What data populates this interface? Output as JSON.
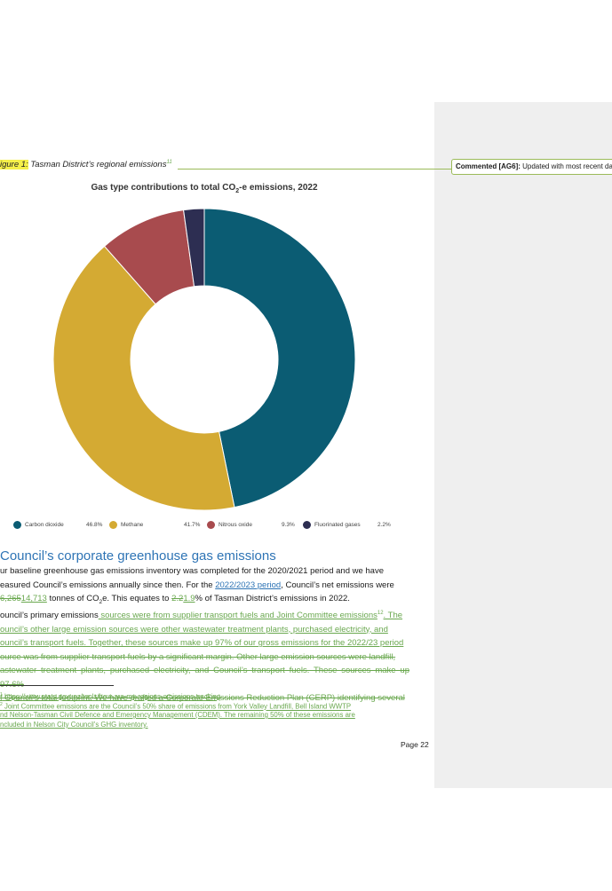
{
  "comment": {
    "label": "Commented [AG6]:",
    "text": " Updated with most recent da"
  },
  "caption": {
    "prefix": "igure 1",
    "marker": ":",
    "text": " Tasman District’s regional emissions",
    "ref": "11"
  },
  "chart_data": {
    "type": "pie",
    "title": "Gas type contributions to total CO",
    "title_sub": "2",
    "title_suffix": "-e emissions, 2022",
    "slices": [
      {
        "label": "Carbon dioxide",
        "value": 46.8,
        "pct_text": "46.8%",
        "color": "#0b5c73"
      },
      {
        "label": "Methane",
        "value": 41.7,
        "pct_text": "41.7%",
        "color": "#d4aa33"
      },
      {
        "label": "Nitrous oxide",
        "value": 9.3,
        "pct_text": "9.3%",
        "color": "#a84b4e"
      },
      {
        "label": "Fluorinated gases",
        "value": 2.2,
        "pct_text": "2.2%",
        "color": "#2d2e52"
      }
    ]
  },
  "section": {
    "heading": "Council’s corporate greenhouse gas emissions"
  },
  "para1": {
    "l1": "ur baseline greenhouse gas emissions inventory was completed for the 2020/2021 period and we have",
    "l2a": "easured Council’s emissions annually since then. For the ",
    "l2link": "2022/2023 period",
    "l2b": ", Council’s net emissions were",
    "l3del1": "6,265",
    "l3ins1": "14,713",
    "l3a": " tonnes of CO",
    "l3sub": "2",
    "l3b": "e. This equates to ",
    "l3del2": "2.2",
    "l3ins2": "1.9",
    "l3c": "% of Tasman District’s emissions in 2022."
  },
  "para2": {
    "l1a": "ouncil’s primary emissions",
    "l1ins": " sources were from supplier transport fuels and Joint Committee emissions",
    "l1ref": "12",
    "l1ins2": ". The",
    "l2": "ouncil’s other large emission sources were other wastewater treatment plants, purchased electricity, and",
    "l3": "ouncil’s transport fuels. Together, these sources make up 97% of our gross emissions for the 2022/23 period",
    "l4": "ource was from supplier transport fuels by a significant margin. Other large emission sources were landfill,",
    "l5": "astewater treatment plants, purchased electricity, and Council’s transport fuels. These sources make up 97.6%",
    "l6": "f Council’s total footprint. We have drafted a Corporate Emissions Reduction Plan (CERP) identifying several"
  },
  "footnotes": {
    "f1num": "1",
    "f1": " https://www.stats.govt.nz/tools/how-are-my-regions-emissions-tracking",
    "f2num": "2",
    "f2": " Joint Committee emissions are the Council’s 50% share of emissions from York Valley Landfill, Bell Island WWTP",
    "f3": "nd Nelson-Tasman Civil Defence and Emergency Management (CDEM). The remaining 50% of these emissions are",
    "f4": "ncluded in Nelson City Council’s GHG inventory."
  },
  "page": {
    "label": "Page 22"
  }
}
